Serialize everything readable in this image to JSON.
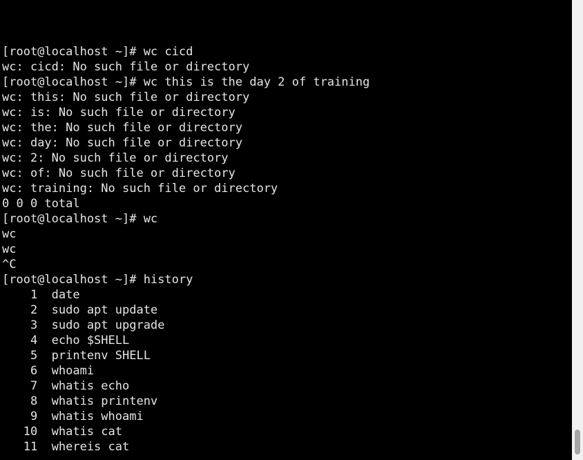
{
  "terminal": {
    "lines": [
      "[root@localhost ~]# wc cicd",
      "wc: cicd: No such file or directory",
      "[root@localhost ~]# wc this is the day 2 of training",
      "wc: this: No such file or directory",
      "wc: is: No such file or directory",
      "wc: the: No such file or directory",
      "wc: day: No such file or directory",
      "wc: 2: No such file or directory",
      "wc: of: No such file or directory",
      "wc: training: No such file or directory",
      "0 0 0 total",
      "[root@localhost ~]# wc",
      "wc",
      "wc",
      "^C",
      "[root@localhost ~]# history",
      "    1  date",
      "    2  sudo apt update",
      "    3  sudo apt upgrade",
      "    4  echo $SHELL",
      "    5  printenv SHELL",
      "    6  whoami",
      "    7  whatis echo",
      "    8  whatis printenv",
      "    9  whatis whoami",
      "   10  whatis cat",
      "   11  whereis cat"
    ]
  },
  "colors": {
    "background": "#000000",
    "text": "#e6e6e6",
    "scrollbar_track": "#f1f1f1",
    "scrollbar_thumb": "#a6a6a6"
  },
  "scroll": {
    "position_fraction": 1.0
  }
}
